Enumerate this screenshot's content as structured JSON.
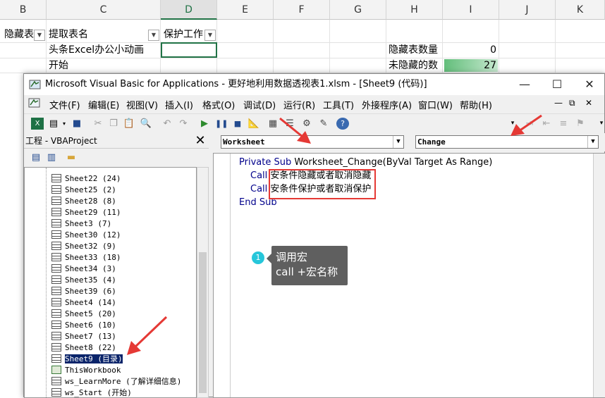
{
  "excel": {
    "columns": [
      "B",
      "C",
      "D",
      "E",
      "F",
      "G",
      "H",
      "I",
      "J",
      "K"
    ],
    "selected_column": "D",
    "header_row": {
      "b": "隐藏表",
      "c": "提取表名",
      "d": "保护工作"
    },
    "cells": {
      "c2": "头条Excel办公小动画",
      "c3": "开始",
      "h2": "隐藏表数量",
      "i2": "0",
      "h3": "未隐藏的数",
      "i3": "27"
    },
    "databar_color": "#63be7b"
  },
  "vba": {
    "title": "Microsoft Visual Basic for Applications - 更好地利用数据透视表1.xlsm - [Sheet9 (代码)]",
    "window_buttons": {
      "minimize": "—",
      "maximize": "☐",
      "close": "✕"
    },
    "menu": [
      "文件(F)",
      "编辑(E)",
      "视图(V)",
      "插入(I)",
      "格式(O)",
      "调试(D)",
      "运行(R)",
      "工具(T)",
      "外接程序(A)",
      "窗口(W)",
      "帮助(H)"
    ],
    "doc_buttons": {
      "minimize": "—",
      "restore": "⧉",
      "close": "✕"
    },
    "project": {
      "header": "工程 - VBAProject",
      "close": "✕",
      "items": [
        {
          "label": "Sheet22 (24)",
          "type": "sheet"
        },
        {
          "label": "Sheet25 (2)",
          "type": "sheet"
        },
        {
          "label": "Sheet28 (8)",
          "type": "sheet"
        },
        {
          "label": "Sheet29 (11)",
          "type": "sheet"
        },
        {
          "label": "Sheet3 (7)",
          "type": "sheet"
        },
        {
          "label": "Sheet30 (12)",
          "type": "sheet"
        },
        {
          "label": "Sheet32 (9)",
          "type": "sheet"
        },
        {
          "label": "Sheet33 (18)",
          "type": "sheet"
        },
        {
          "label": "Sheet34 (3)",
          "type": "sheet"
        },
        {
          "label": "Sheet35 (4)",
          "type": "sheet"
        },
        {
          "label": "Sheet39 (6)",
          "type": "sheet"
        },
        {
          "label": "Sheet4 (14)",
          "type": "sheet"
        },
        {
          "label": "Sheet5 (20)",
          "type": "sheet"
        },
        {
          "label": "Sheet6 (10)",
          "type": "sheet"
        },
        {
          "label": "Sheet7 (13)",
          "type": "sheet"
        },
        {
          "label": "Sheet8 (22)",
          "type": "sheet"
        },
        {
          "label": "Sheet9 (目录)",
          "type": "sheet",
          "selected": true
        },
        {
          "label": "ThisWorkbook",
          "type": "workbook"
        },
        {
          "label": "ws_LearnMore (了解详细信息)",
          "type": "sheet"
        },
        {
          "label": "ws_Start (开始)",
          "type": "sheet"
        }
      ]
    },
    "object_combo": "Worksheet",
    "procedure_combo": "Change",
    "code": {
      "line1_kw": "Private Sub",
      "line1_rest": " Worksheet_Change(ByVal Target As Range)",
      "call_kw": "Call",
      "call1": "安条件隐藏或者取消隐藏",
      "call2": "安条件保护或者取消保护",
      "end_kw": "End Sub"
    },
    "callout": {
      "number": "1",
      "line1": "调用宏",
      "line2": "call +宏名称"
    }
  }
}
